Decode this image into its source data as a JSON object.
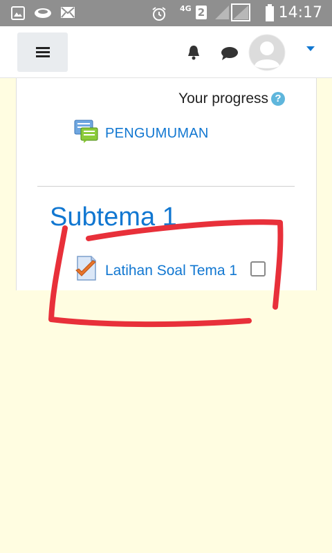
{
  "status_bar": {
    "network": "4G",
    "sim": "2",
    "time": "14:17",
    "icons": [
      "gallery-icon",
      "cloud-icon",
      "mail-icon",
      "alarm-icon",
      "signal-icon",
      "battery-icon"
    ]
  },
  "header": {
    "menu_icon": "hamburger-icon",
    "notification_icon": "bell-icon",
    "message_icon": "chat-icon",
    "avatar_icon": "user-avatar-icon",
    "dropdown_icon": "caret-down-icon"
  },
  "course": {
    "progress_label": "Your progress",
    "help_icon_text": "?",
    "announcement_link": "PENGUMUMAN",
    "section_title": "Subtema 1",
    "activity_link": "Latihan Soal Tema 1",
    "activity_completed": false
  },
  "colors": {
    "link": "#1177d1",
    "status_bar": "#8f8f8f",
    "background": "#fffde1",
    "annotation": "#e8303a"
  }
}
